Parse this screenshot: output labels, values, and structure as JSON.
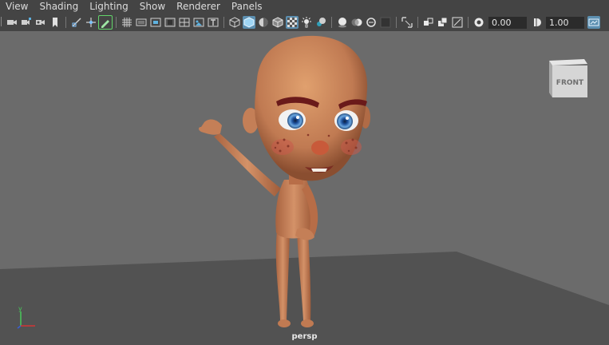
{
  "menubar": {
    "items": [
      "View",
      "Shading",
      "Lighting",
      "Show",
      "Renderer",
      "Panels"
    ]
  },
  "toolbar": {
    "exposure_value": "0.00",
    "gamma_value": "1.00",
    "icons": [
      "camera-select-icon",
      "camera-attributes-icon",
      "bookmarks-icon",
      "image-plane-icon",
      "2d-pan-zoom-icon",
      "grease-pencil-icon",
      "grid-icon",
      "film-gate-icon",
      "resolution-gate-icon",
      "gate-mask-icon",
      "field-chart-icon",
      "safe-action-icon",
      "safe-title-icon",
      "wireframe-icon",
      "smooth-shade-icon",
      "use-default-material-icon",
      "wireframe-on-shaded-icon",
      "xray-icon",
      "lights-icon",
      "shadows-icon",
      "screen-space-ambient-occlusion-icon",
      "motion-blur-icon",
      "multisample-aa-icon",
      "depth-of-field-icon",
      "isolate-select-icon",
      "xray-joints-icon",
      "xray-active-components-icon",
      "backface-culling-icon",
      "exposure-icon",
      "gamma-icon",
      "color-management-icon"
    ]
  },
  "viewport": {
    "viewcube_label": "FRONT",
    "camera_label": "persp",
    "axis_labels": {
      "x": "x",
      "y": "y",
      "z": "z"
    }
  },
  "colors": {
    "ui_bg": "#444444",
    "viewport_bg": "#6b6b6b",
    "floor": "#525252",
    "skin": "#c88660",
    "accent_blue": "#5c8fb0",
    "accent_green": "#62d36a"
  }
}
